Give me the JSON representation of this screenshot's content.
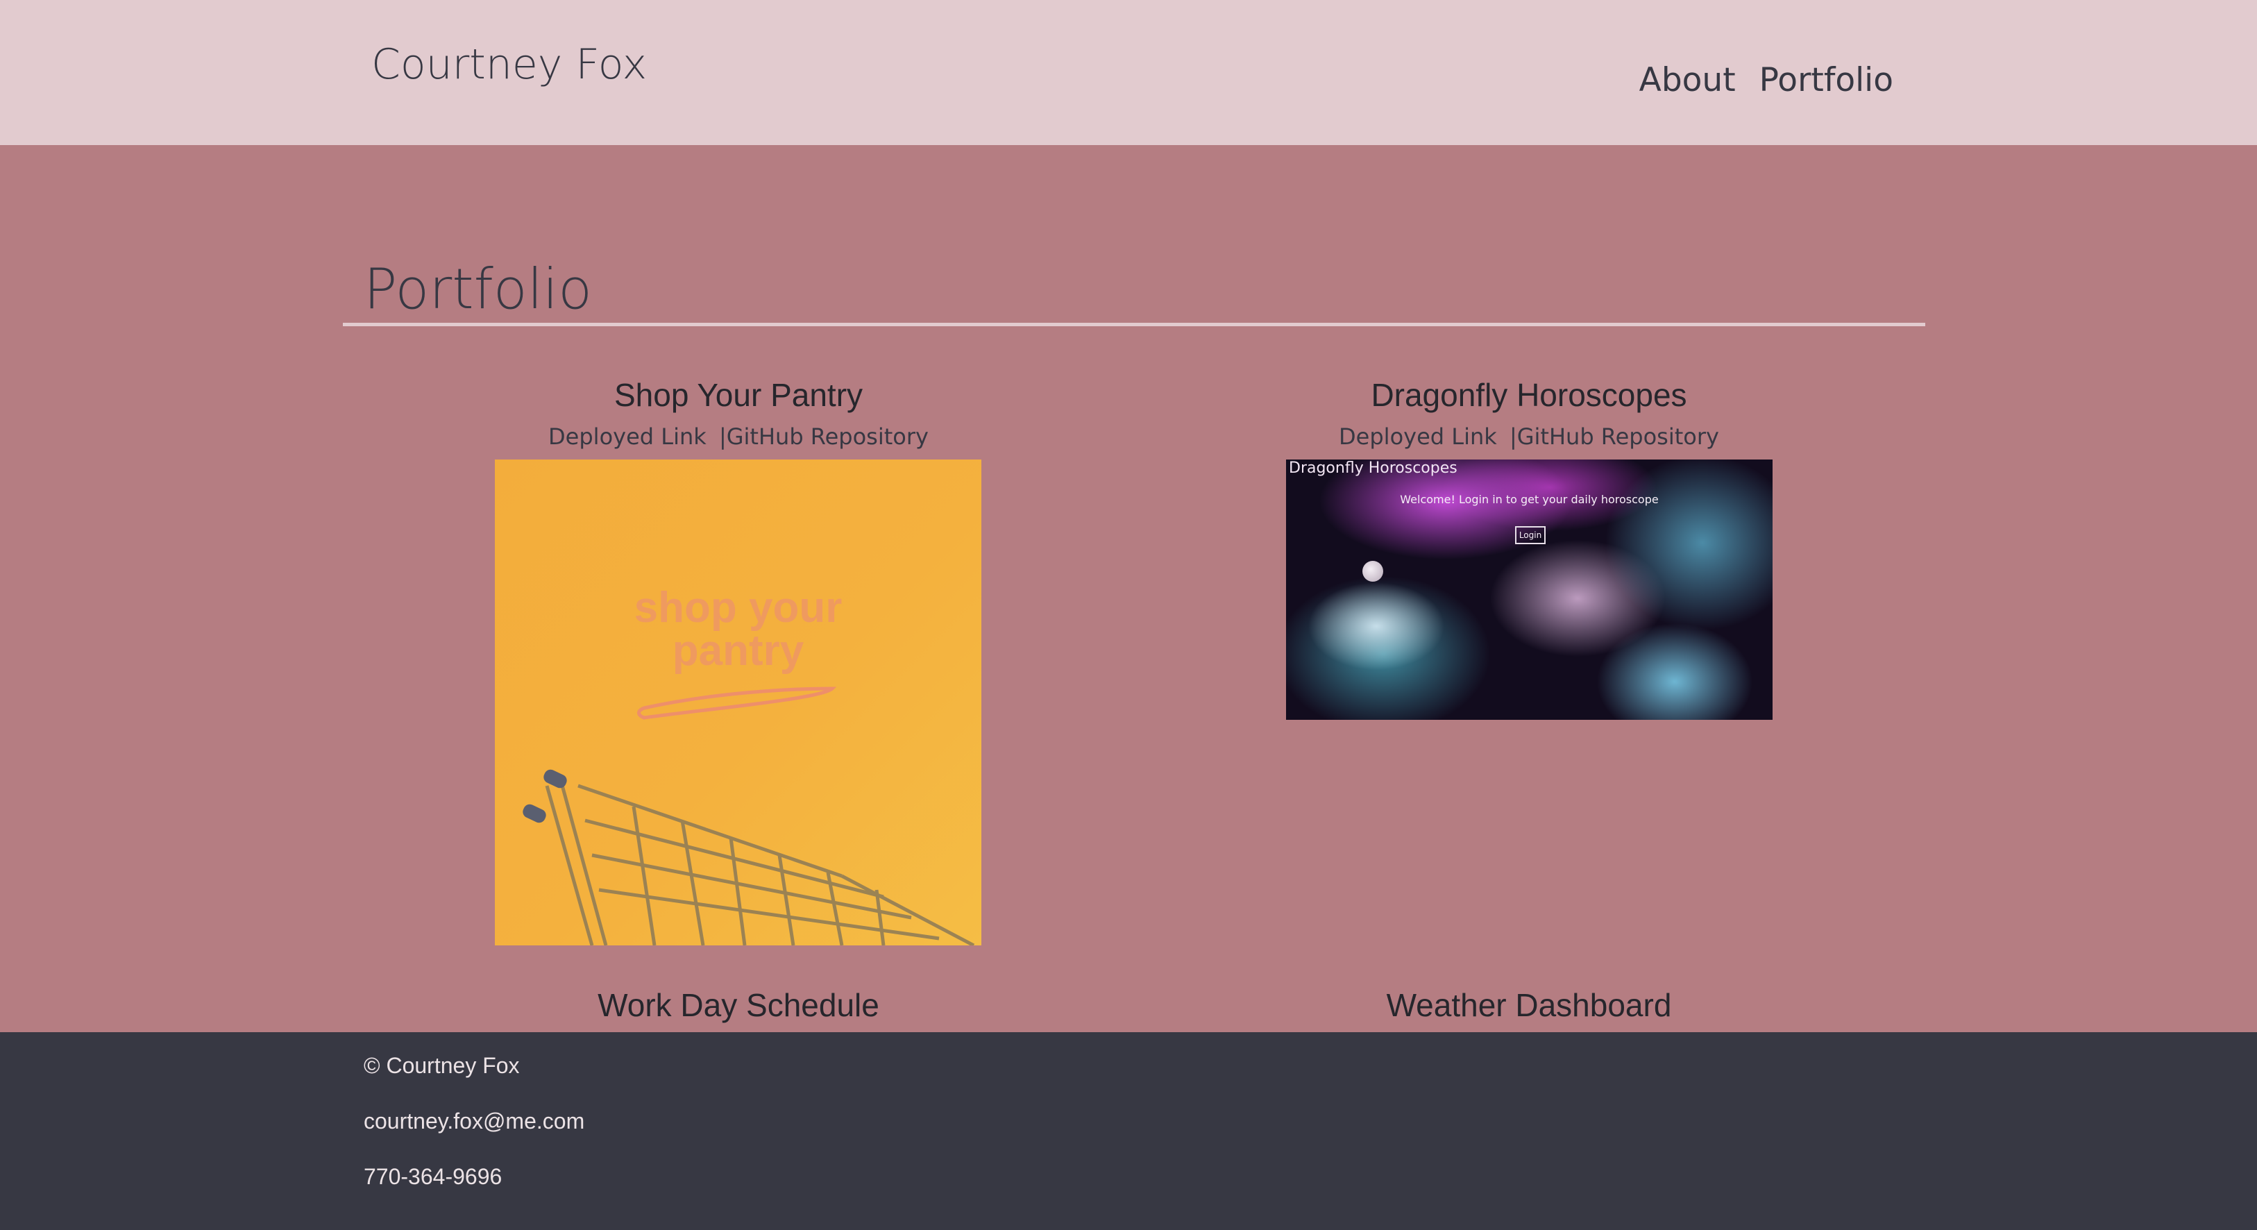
{
  "header": {
    "site_title": "Courtney Fox",
    "nav": [
      {
        "label": "About"
      },
      {
        "label": "Portfolio"
      }
    ]
  },
  "portfolio": {
    "heading": "Portfolio",
    "projects": [
      {
        "title": "Shop Your Pantry",
        "deployed_link": "Deployed Link",
        "separator": "|",
        "repo_link": "GitHub Repository",
        "image_alt": "shop your pantry",
        "logo_lines": [
          "shop your",
          "pantry"
        ]
      },
      {
        "title": "Dragonfly Horoscopes",
        "deployed_link": "Deployed Link",
        "separator": "|",
        "repo_link": "GitHub Repository",
        "screenshot_title": "Dragonfly Horoscopes",
        "screenshot_welcome": "Welcome! Login in to get your daily horoscope",
        "screenshot_login": "Login"
      },
      {
        "title": "Work Day Schedule"
      },
      {
        "title": "Weather Dashboard"
      }
    ]
  },
  "footer": {
    "copyright": "© Courtney Fox",
    "email": "courtney.fox@me.com",
    "phone": "770-364-9696"
  }
}
